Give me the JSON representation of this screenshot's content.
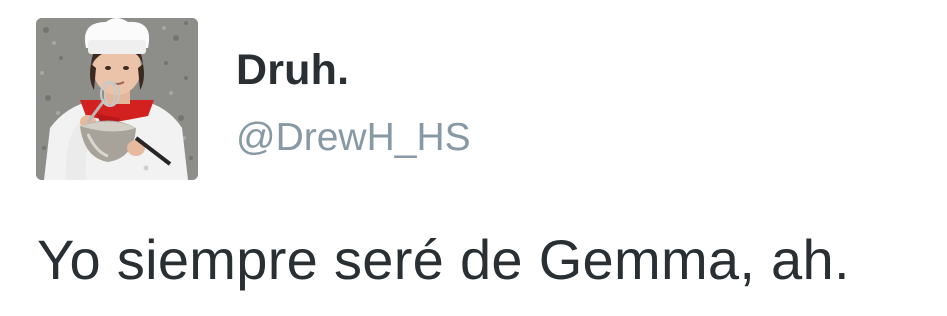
{
  "tweet": {
    "display_name": "Druh.",
    "handle": "@DrewH_HS",
    "text": "Yo siempre seré de Gemma, ah."
  },
  "colors": {
    "name": "#292f33",
    "handle": "#8899a6",
    "text": "#292f33",
    "background": "#ffffff"
  },
  "icons": {
    "avatar": "profile-photo-chef-with-mixing-bowl"
  }
}
